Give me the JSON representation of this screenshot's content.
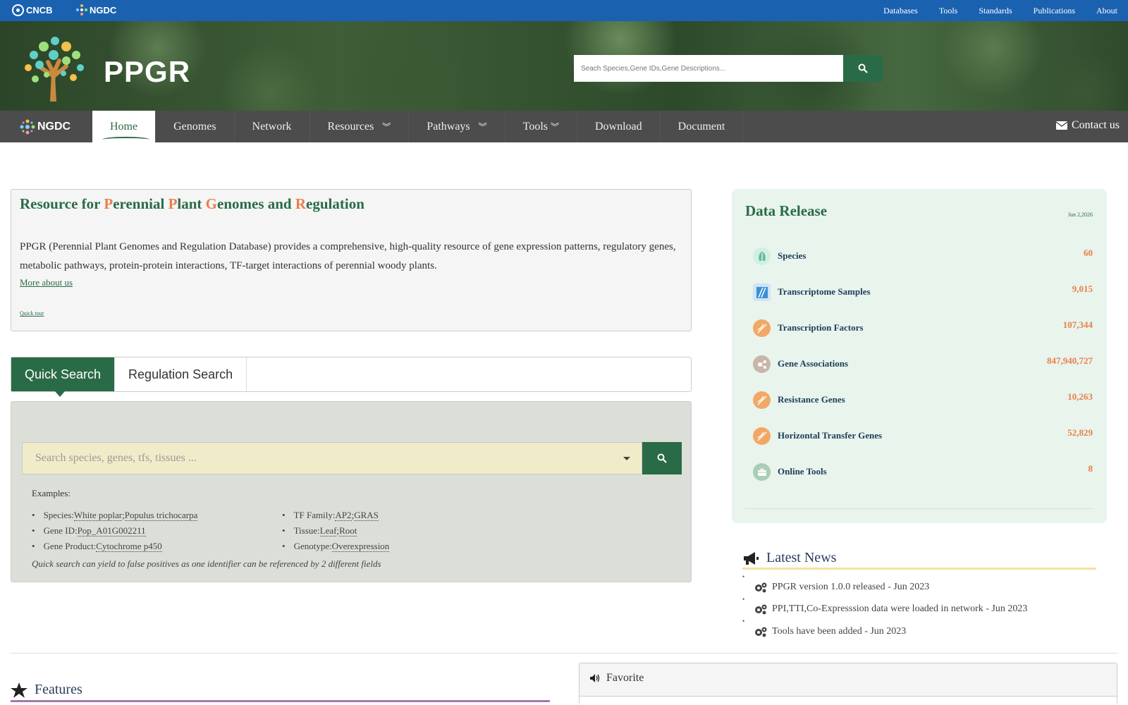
{
  "topbar": {
    "logo1": "CNCB",
    "logo2": "NGDC",
    "nav": [
      "Databases",
      "Tools",
      "Standards",
      "Publications",
      "About"
    ]
  },
  "banner": {
    "brand": "PPGR",
    "search_placeholder": "Seach Species,Gene IDs,Gene Descriptions..."
  },
  "navbar": {
    "logo": "NGDC",
    "items": [
      "Home",
      "Genomes",
      "Network",
      "Resources",
      "Pathways",
      "Tools",
      "Download",
      "Document"
    ],
    "contact": "Contact us"
  },
  "intro": {
    "title_parts": [
      "Resource for ",
      "P",
      "erennial ",
      "P",
      "lant ",
      "G",
      "enomes and ",
      "R",
      "egulation"
    ],
    "description": "PPGR (Perennial Plant Genomes and Regulation Database) provides a comprehensive, high-quality resource of gene expression patterns, regulatory genes, metabolic pathways, protein-protein interactions, TF-target interactions of perennial woody plants.",
    "more_link": "More about us",
    "tour_link": "Quick tour"
  },
  "search_tabs": [
    "Quick Search",
    "Regulation Search"
  ],
  "quick_search": {
    "placeholder": "Search species, genes, tfs, tissues ...",
    "examples_title": "Examples:",
    "left": [
      {
        "label": "Species:",
        "links": [
          "White poplar",
          "Populus trichocarpa"
        ]
      },
      {
        "label": "Gene ID:",
        "links": [
          "Pop_A01G002211"
        ]
      },
      {
        "label": "Gene Product:",
        "links": [
          "Cytochrome p450"
        ]
      }
    ],
    "right": [
      {
        "label": "TF Family:",
        "links": [
          "AP2",
          "GRAS"
        ]
      },
      {
        "label": "Tissue:",
        "links": [
          "Leaf",
          "Root"
        ]
      },
      {
        "label": "Genotype:",
        "links": [
          "Overexpression"
        ]
      }
    ],
    "note": "Quick search can yield to false positives as one identifier can be referenced by 2 different fields"
  },
  "data_release": {
    "title": "Data Release",
    "date": "Jun 2,2026",
    "rows": [
      {
        "label": "Species",
        "value": "60",
        "icon": "leaf-icon",
        "color": "#5fbf9a"
      },
      {
        "label": "Transcriptome Samples",
        "value": "9,015",
        "icon": "sample-icon",
        "color": "#3b8fd6"
      },
      {
        "label": "Transcription Factors",
        "value": "107,344",
        "icon": "dna-icon",
        "color": "#f2a765"
      },
      {
        "label": "Gene Associations",
        "value": "847,940,727",
        "icon": "network-icon",
        "color": "#c8b6a8"
      },
      {
        "label": "Resistance Genes",
        "value": "10,263",
        "icon": "dna-icon",
        "color": "#f2a765"
      },
      {
        "label": "Horizontal Transfer Genes",
        "value": "52,829",
        "icon": "dna-icon",
        "color": "#f2a765"
      },
      {
        "label": "Online Tools",
        "value": "8",
        "icon": "toolbox-icon",
        "color": "#8fb8a0"
      }
    ]
  },
  "news": {
    "title": "Latest News",
    "items": [
      "PPGR version 1.0.0 released - Jun 2023",
      "PPI,TTI,Co-Expresssion data were loaded in network - Jun 2023",
      "Tools have been added - Jun 2023"
    ]
  },
  "features": {
    "title": "Features"
  },
  "favorite": {
    "title": "Favorite"
  }
}
